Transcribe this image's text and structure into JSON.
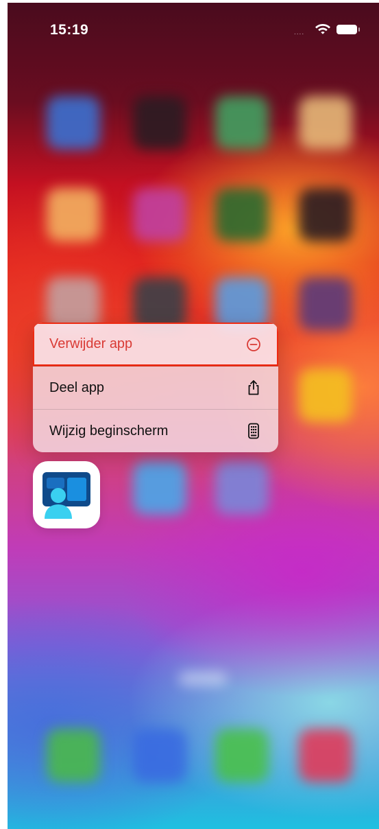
{
  "status_bar": {
    "time": "15:19",
    "signal_text": "....",
    "wifi_icon": "wifi-icon",
    "battery_icon": "battery-icon"
  },
  "context_menu": {
    "items": [
      {
        "label": "Verwijder app",
        "icon": "minus-circle-icon",
        "color": "#d93a34",
        "highlighted": true
      },
      {
        "label": "Deel app",
        "icon": "share-icon"
      },
      {
        "label": "Wijzig beginscherm",
        "icon": "phone-icon"
      }
    ]
  },
  "app": {
    "icon": "remote-desktop-app-icon",
    "brand_colors": [
      "#0f4a8a",
      "#1a8fe0",
      "#3ad0f0"
    ]
  },
  "colors": {
    "highlight_border": "#ee2a12",
    "menu_background": "#f4e0e8"
  }
}
